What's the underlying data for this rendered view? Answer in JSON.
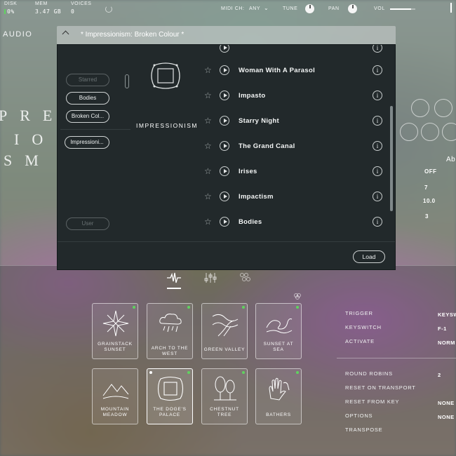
{
  "status": {
    "disk_label": "DISK",
    "disk_value": "0%",
    "mem_label": "MEM",
    "mem_value": "3.47 GB",
    "voices_label": "VOICES",
    "voices_value": "0"
  },
  "controls": {
    "midi_label": "MIDI CH:",
    "midi_value": "ANY",
    "tune_label": "TUNE",
    "pan_label": "PAN",
    "vol_label": "VOL",
    "vol_level": 0.82
  },
  "brand": "AUDIO",
  "background_letters": [
    "PRE",
    "IO",
    "SM"
  ],
  "right_panel": {
    "heading": "Ab",
    "values": [
      "OFF",
      "7",
      "10.0",
      "3"
    ]
  },
  "browser": {
    "title": "* Impressionism: Broken Colour *",
    "filters": [
      "Starred",
      "Bodies",
      "Broken Col...",
      "Impressioni..."
    ],
    "user_label": "User",
    "instrument": "IMPRESSIONISM",
    "presets": [
      "Woman With A Parasol",
      "Impasto",
      "Starry Night",
      "The Grand Canal",
      "Irises",
      "Impactism",
      "Bodies"
    ],
    "load_label": "Load"
  },
  "tiles": [
    {
      "label": "Grainstack Sunset",
      "icon": "star-burst-icon"
    },
    {
      "label": "Arch to the West",
      "icon": "rain-cloud-icon"
    },
    {
      "label": "Green Valley",
      "icon": "valley-icon"
    },
    {
      "label": "Sunset at Sea",
      "icon": "wave-icon"
    },
    {
      "label": "Mountain Meadow",
      "icon": "mountain-icon"
    },
    {
      "label": "The Doge's Palace",
      "icon": "frame-icon"
    },
    {
      "label": "Chestnut Tree",
      "icon": "trees-icon"
    },
    {
      "label": "Bathers",
      "icon": "hands-icon"
    }
  ],
  "params": [
    {
      "label": "TRIGGER",
      "value": "KEYSW"
    },
    {
      "label": "KEYSWITCH",
      "value": "F-1"
    },
    {
      "label": "ACTIVATE",
      "value": "NORM"
    },
    {
      "label": "ROUND ROBINS",
      "value": "2"
    },
    {
      "label": "RESET ON TRANSPORT",
      "value": ""
    },
    {
      "label": "RESET FROM KEY",
      "value": "NONE"
    },
    {
      "label": "OPTIONS",
      "value": "NONE"
    },
    {
      "label": "TRANSPOSE",
      "value": ""
    }
  ],
  "colors": {
    "accent": "#5fd35f",
    "panel": "#22292b",
    "text": "#f4f6f6"
  }
}
